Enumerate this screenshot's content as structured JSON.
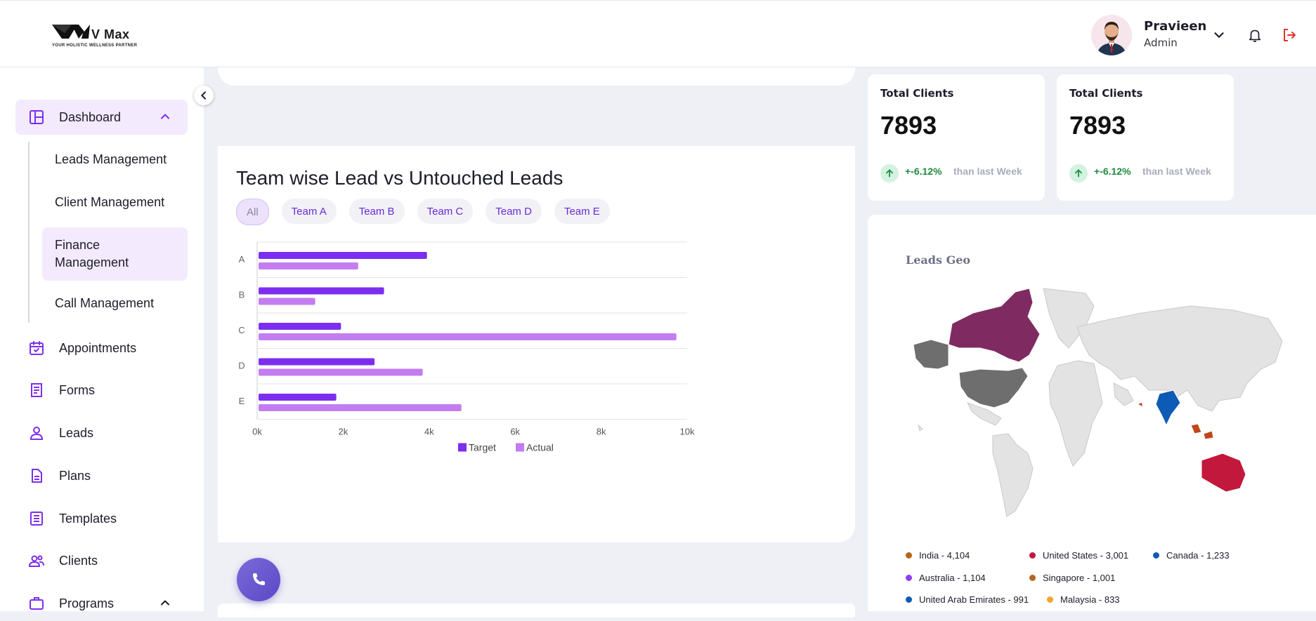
{
  "brand": {
    "name": "V Max",
    "tagline": "YOUR HOLISTIC WELLNESS PARTNER"
  },
  "user": {
    "name": "Pravieen",
    "role": "Admin"
  },
  "sidebar": {
    "items": [
      {
        "label": "Dashboard",
        "icon": "dashboard-icon",
        "active": true,
        "expanded": true
      },
      {
        "label": "Appointments",
        "icon": "calendar-check-icon"
      },
      {
        "label": "Forms",
        "icon": "form-icon"
      },
      {
        "label": "Leads",
        "icon": "user-icon"
      },
      {
        "label": "Plans",
        "icon": "document-icon"
      },
      {
        "label": "Templates",
        "icon": "template-icon"
      },
      {
        "label": "Clients",
        "icon": "users-icon"
      },
      {
        "label": "Programs",
        "icon": "briefcase-icon",
        "expanded": true
      }
    ],
    "sub_items": [
      {
        "label": "Leads Management"
      },
      {
        "label": "Client Management"
      },
      {
        "label": "Finance Management",
        "active": true
      },
      {
        "label": "Call Management"
      }
    ]
  },
  "chart_card": {
    "title": "Team wise Lead vs Untouched Leads",
    "tabs": [
      "All",
      "Team A",
      "Team B",
      "Team C",
      "Team D",
      "Team E"
    ],
    "active_tab": "All"
  },
  "chart_data": {
    "type": "bar",
    "orientation": "horizontal",
    "categories": [
      "A",
      "B",
      "C",
      "D",
      "E"
    ],
    "series": [
      {
        "name": "Target",
        "values": [
          3950,
          2950,
          1950,
          2730,
          1840
        ],
        "color": "#7c2ef0"
      },
      {
        "name": "Actual",
        "values": [
          2350,
          1350,
          9750,
          3850,
          4750
        ],
        "color": "#c37df0"
      }
    ],
    "xlim": [
      0,
      10000
    ],
    "x_ticks": [
      "0k",
      "2k",
      "4k",
      "6k",
      "8k",
      "10k"
    ],
    "legend_position": "bottom",
    "grid": true
  },
  "stats": [
    {
      "title": "Total Clients",
      "value": "7893",
      "change": "+-6.12%",
      "note": "than last Week"
    },
    {
      "title": "Total Clients",
      "value": "7893",
      "change": "+-6.12%",
      "note": "than last Week"
    }
  ],
  "geo": {
    "title": "Leads Geo",
    "legend": [
      {
        "label": "India - 4,104",
        "color": "#b5651d"
      },
      {
        "label": "United States - 3,001",
        "color": "#c2183b"
      },
      {
        "label": "Canada - 1,233",
        "color": "#0d5bb5"
      },
      {
        "label": "Australia - 1,104",
        "color": "#8a3ff0"
      },
      {
        "label": "Singapore - 1,001",
        "color": "#b5651d"
      },
      {
        "label": "United Arab Emirates - 991",
        "color": "#0d5bb5"
      },
      {
        "label": "Malaysia - 833",
        "color": "#f4a52b"
      }
    ],
    "map_colors": {
      "canada": "#7f2b62",
      "alaska": "#6e6e6e",
      "usa": "#6e6e6e",
      "india": "#0d5bb5",
      "australia": "#c2183b",
      "se_asia": "#c0461a",
      "land": "#e3e3e3"
    }
  },
  "colors": {
    "accent": "#7c2ef0",
    "logout": "#e5322d"
  }
}
